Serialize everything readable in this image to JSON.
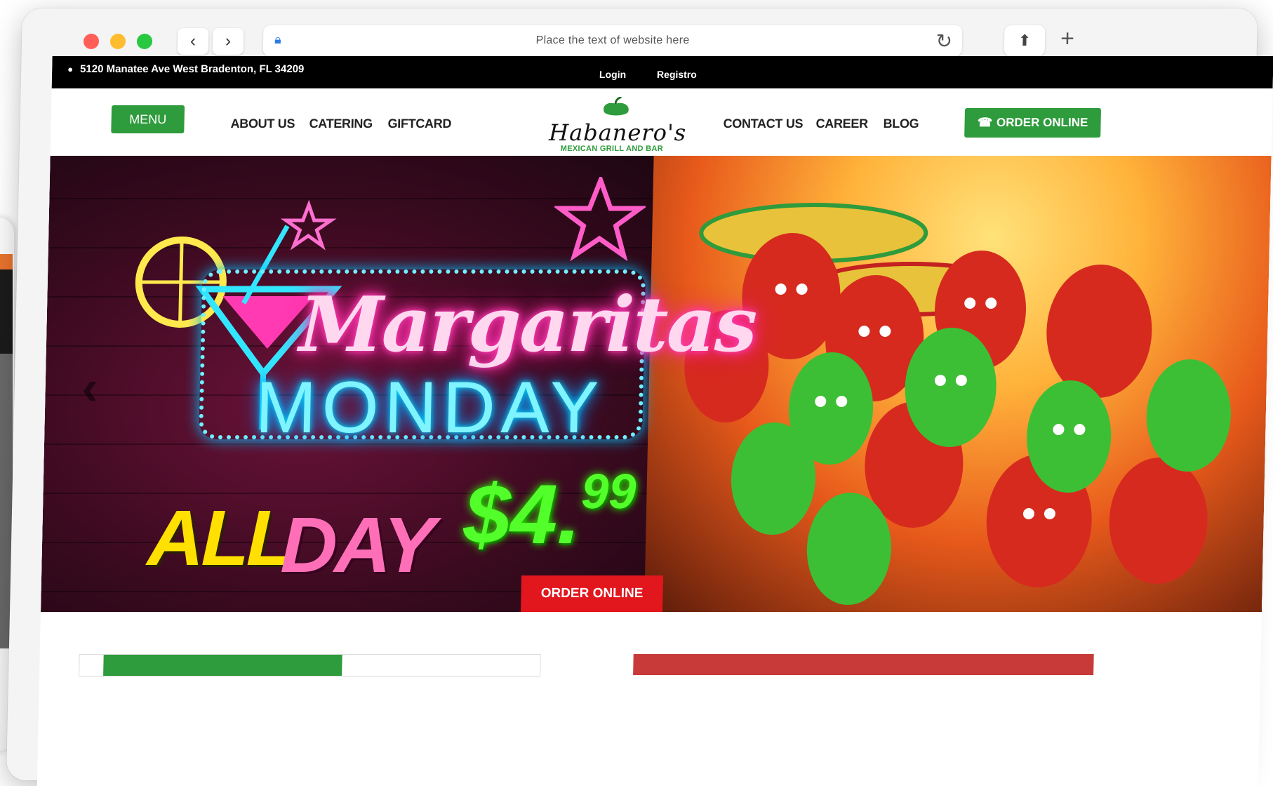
{
  "browser": {
    "url_placeholder": "Place the text of website here",
    "back_icon": "‹",
    "forward_icon": "›"
  },
  "topbar": {
    "address": "5120 Manatee Ave West Bradenton, FL 34209",
    "login": "Login",
    "registro": "Registro"
  },
  "nav": {
    "menu": "MENU",
    "about": "ABOUT US",
    "catering": "CATERING",
    "giftcard": "GIFTCARD",
    "contact": "CONTACT US",
    "career": "CAREER",
    "blog": "BLOG",
    "order_online": "ORDER ONLINE"
  },
  "logo": {
    "name": "Habanero's",
    "tagline": "MEXICAN GRILL AND BAR"
  },
  "hero": {
    "title": "Margaritas",
    "subtitle": "MONDAY",
    "all": "ALL",
    "day": "DAY",
    "price_main": "$4.",
    "price_cents": "99",
    "order_online": "ORDER ONLINE"
  },
  "colors": {
    "brand_green": "#2e9b3c",
    "order_red": "#e2161d",
    "topbar_black": "#000000"
  }
}
